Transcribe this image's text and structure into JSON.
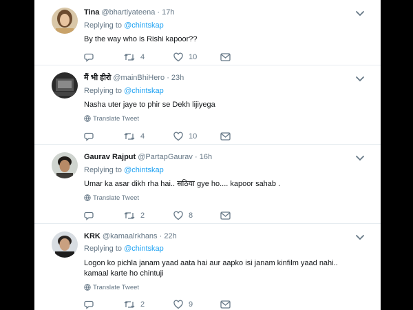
{
  "tweets": [
    {
      "name": "Tina",
      "handle": "@bhartiyateena",
      "separator": "·",
      "time": "17h",
      "replying_prefix": "Replying to",
      "replying_to": "@chintskap",
      "text": "By the way who is Rishi kapoor??",
      "replies": "",
      "retweets": "4",
      "likes": "10"
    },
    {
      "name": "मैं भी हीरो",
      "handle": "@mainBhiHero",
      "separator": "·",
      "time": "23h",
      "replying_prefix": "Replying to",
      "replying_to": "@chintskap",
      "text": "Nasha uter jaye to phir se Dekh lijiyega",
      "translate": "Translate Tweet",
      "replies": "",
      "retweets": "4",
      "likes": "10"
    },
    {
      "name": "Gaurav Rajput",
      "handle": "@PartapGaurav",
      "separator": "·",
      "time": "16h",
      "replying_prefix": "Replying to",
      "replying_to": "@chintskap",
      "text": "Umar ka asar dikh rha hai.. सठिया gye ho.... kapoor sahab .",
      "translate": "Translate Tweet",
      "replies": "",
      "retweets": "2",
      "likes": "8"
    },
    {
      "name": "KRK",
      "handle": "@kamaalrkhans",
      "separator": "·",
      "time": "22h",
      "replying_prefix": "Replying to",
      "replying_to": "@chintskap",
      "text_line1": "Logon ko pichla janam yaad aata hai aur aapko isi janam kinfilm yaad nahi..",
      "text_line2": "kamaal karte ho chintuji",
      "translate": "Translate Tweet",
      "replies": "",
      "retweets": "2",
      "likes": "9"
    }
  ],
  "icons": {
    "reply": "reply-icon",
    "retweet": "retweet-icon",
    "like": "heart-icon",
    "dm": "envelope-icon",
    "caret": "chevron-down-icon",
    "translate": "globe-icon"
  },
  "colors": {
    "link": "#1da1f2",
    "secondary": "#657786",
    "text": "#14171a",
    "divider": "#e6ecf0"
  }
}
